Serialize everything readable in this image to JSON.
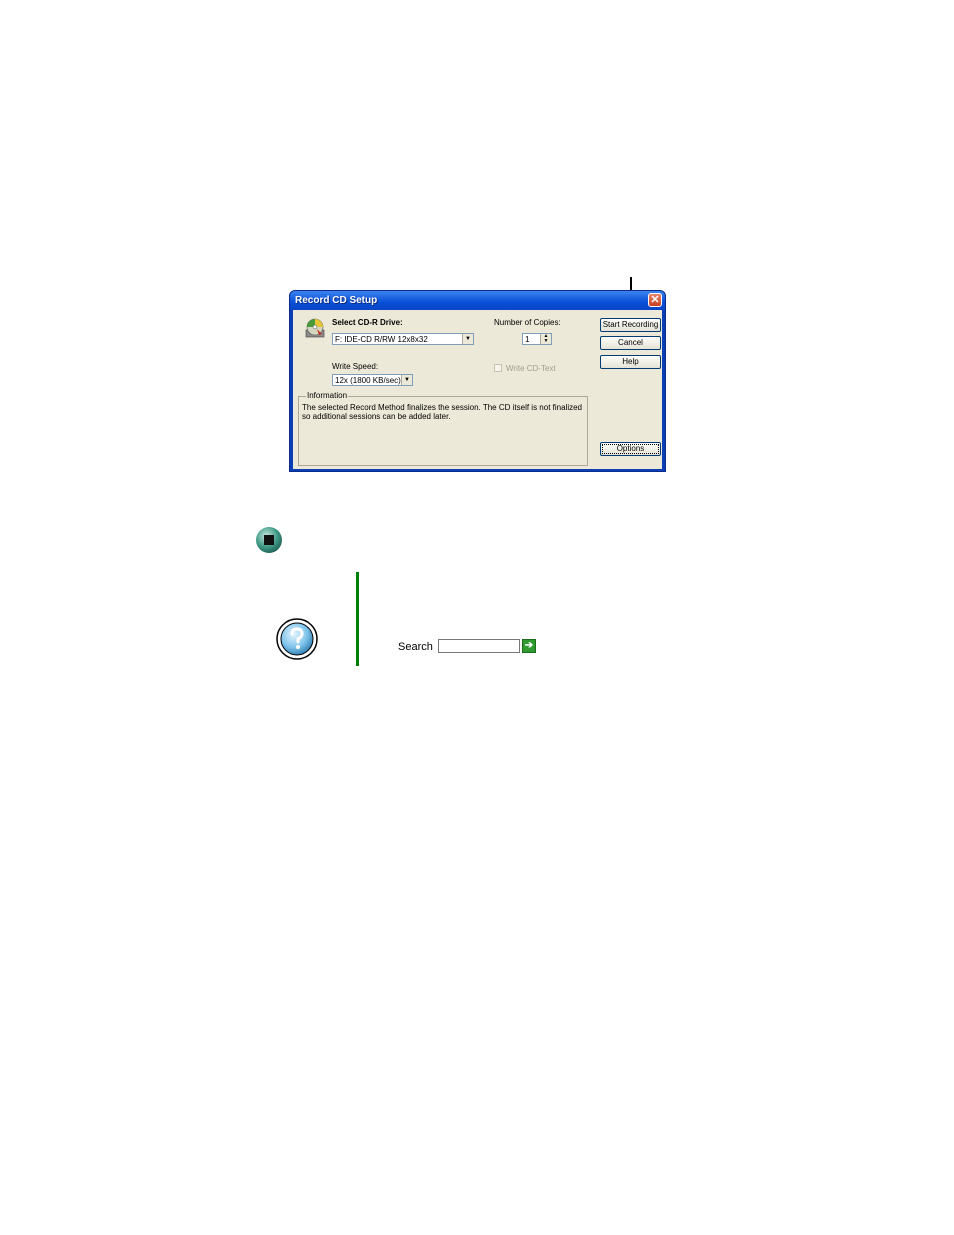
{
  "dialog": {
    "title": "Record CD Setup",
    "close_glyph": "✕",
    "select_drive_label": "Select CD-R Drive:",
    "drive_value": "F: IDE-CD R/RW 12x8x32",
    "copies_label": "Number of Copies:",
    "copies_value": "1",
    "write_speed_label": "Write Speed:",
    "write_speed_value": "12x (1800 KB/sec)",
    "write_cd_text_label": "Write CD-Text",
    "write_cd_text_checked": false,
    "information_title": "Information",
    "information_text": "The selected Record Method finalizes the session. The CD itself is not finalized so additional sessions can be added later.",
    "buttons": {
      "start_recording": "Start Recording",
      "cancel": "Cancel",
      "help": "Help",
      "options": "Options"
    },
    "dropdown_glyph": "▼",
    "spin_glyph_up": "▲",
    "spin_glyph_down": "▼"
  },
  "help": {
    "search_label": "Search",
    "search_value": "",
    "go_glyph": "➔"
  },
  "icons": {
    "cd": "cd-recorder-icon",
    "end": "end-mark-icon",
    "help": "help-question-icon"
  },
  "colors": {
    "titlebar": "#0a4fd8",
    "client": "#ece9d8",
    "green_bar": "#008000",
    "go_button": "#2f9a2f"
  }
}
